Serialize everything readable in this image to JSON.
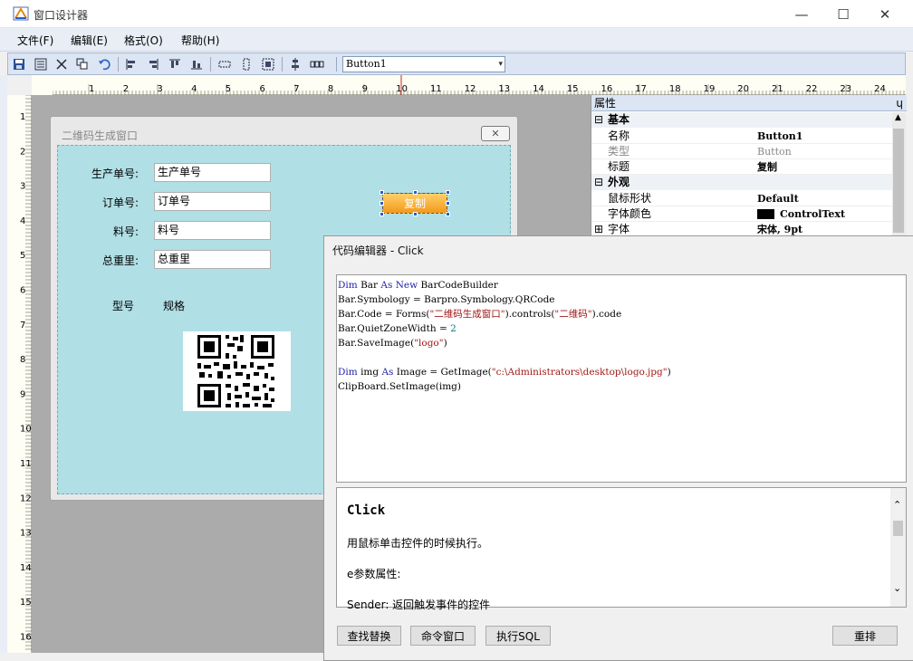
{
  "window": {
    "title": "窗口设计器",
    "min": "—",
    "max": "☐",
    "close": "✕"
  },
  "menu": [
    "文件(F)",
    "编辑(E)",
    "格式(O)",
    "帮助(H)"
  ],
  "toolbar": {
    "object_selector": "Button1"
  },
  "ruler": {
    "h": [
      "1",
      "2",
      "3",
      "4",
      "5",
      "6",
      "7",
      "8",
      "9",
      "10",
      "11",
      "12",
      "13",
      "14",
      "15",
      "16",
      "17",
      "18",
      "19",
      "20",
      "21",
      "22",
      "23",
      "24"
    ],
    "v": [
      "1",
      "2",
      "3",
      "4",
      "5",
      "6",
      "7",
      "8",
      "9",
      "10",
      "11",
      "12",
      "13",
      "14",
      "15",
      "16"
    ]
  },
  "design": {
    "title": "二维码生成窗口",
    "close": "✕",
    "fields": [
      {
        "label": "生产单号:",
        "value": "生产单号"
      },
      {
        "label": "订单号:",
        "value": "订单号"
      },
      {
        "label": "料号:",
        "value": "料号"
      },
      {
        "label": "总重里:",
        "value": "总重里"
      }
    ],
    "copy_button": "复制",
    "model_label": "型号",
    "spec_label": "规格"
  },
  "properties": {
    "header": "属性",
    "pin": "ɥ",
    "cat_basic": "基本",
    "cat_look": "外观",
    "rows_basic": [
      {
        "k": "名称",
        "v": "Button1"
      },
      {
        "k": "类型",
        "v": "Button"
      },
      {
        "k": "标题",
        "v": "复制"
      }
    ],
    "rows_look": [
      {
        "k": "鼠标形状",
        "v": "Default"
      },
      {
        "k": "字体颜色",
        "v": "ControlText"
      },
      {
        "k": "字体",
        "v": "宋体, 9pt"
      }
    ]
  },
  "code_editor": {
    "title": "代码编辑器 - Click",
    "code": [
      [
        [
          "kw",
          "Dim"
        ],
        [
          "",
          "Bar "
        ],
        [
          "kw",
          "As New"
        ],
        [
          "",
          "BarCodeBuilder"
        ]
      ],
      [
        [
          "",
          "Bar.Symbology = Barpro.Symbology.QRCode"
        ]
      ],
      [
        [
          "",
          "Bar.Code = Forms("
        ],
        [
          "st",
          "\"二维码生成窗口\""
        ],
        [
          "",
          ").controls("
        ],
        [
          "st",
          "\"二维码\""
        ],
        [
          "",
          ").code"
        ]
      ],
      [
        [
          "",
          "Bar.QuietZoneWidth = "
        ],
        [
          "nm",
          "2"
        ]
      ],
      [
        [
          "",
          "Bar.SaveImage("
        ],
        [
          "st",
          "\"logo\""
        ],
        [
          "",
          ")"
        ]
      ],
      [
        [
          "",
          ""
        ]
      ],
      [
        [
          "kw",
          "Dim"
        ],
        [
          "",
          "img "
        ],
        [
          "kw",
          "As"
        ],
        [
          "",
          "Image = GetImage("
        ],
        [
          "st",
          "\"c:\\Administrators\\desktop\\logo.jpg\""
        ],
        [
          "",
          ")"
        ]
      ],
      [
        [
          "",
          "ClipBoard.SetImage(img)"
        ]
      ]
    ],
    "help_title": "Click",
    "help_lines": [
      "用鼠标单击控件的时候执行。",
      "e参数属性:",
      "Sender: 返回触发事件的控件"
    ],
    "buttons": [
      "查找替换",
      "命令窗口",
      "执行SQL",
      "重排"
    ]
  }
}
